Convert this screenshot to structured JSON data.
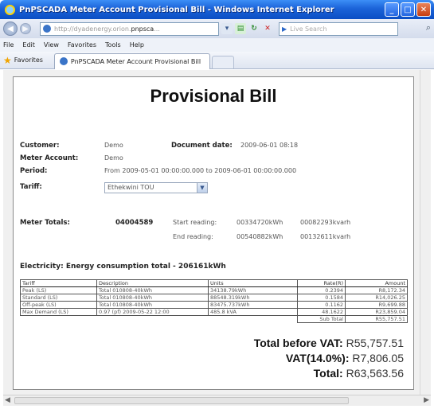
{
  "window": {
    "title": "PnPSCADA Meter Account Provisional Bill - Windows Internet Explorer",
    "min": "_",
    "max": "□",
    "close": "✕"
  },
  "address": {
    "url_prefix": "http://dyadenergy.orion.",
    "url_host": "pnpsca",
    "url_suffix": "...",
    "search_placeholder": "Live Search",
    "search_logo": "▶"
  },
  "menu": [
    "File",
    "Edit",
    "View",
    "Favorites",
    "Tools",
    "Help"
  ],
  "favbar": {
    "favorites_label": "Favorites",
    "tab_title": "PnPSCADA Meter Account Provisional Bill"
  },
  "bill": {
    "title": "Provisional Bill",
    "customer_label": "Customer:",
    "customer_value": "Demo",
    "document_date_label": "Document date:",
    "document_date_value": "2009-06-01 08:18",
    "meter_account_label": "Meter Account:",
    "meter_account_value": "Demo",
    "period_label": "Period:",
    "period_value": "From 2009-05-01 00:00:00.000 to 2009-06-01 00:00:00.000",
    "tariff_label": "Tariff:",
    "tariff_value": "Ethekwini TOU",
    "meter_totals_label": "Meter Totals:",
    "meter_number": "04004589",
    "start_reading_label": "Start reading:",
    "start_reading_kwh": "00334720kWh",
    "start_reading_kvarh": "00082293kvarh",
    "end_reading_label": "End reading:",
    "end_reading_kwh": "00540882kWh",
    "end_reading_kvarh": "00132611kvarh",
    "section_heading": "Electricity: Energy consumption total - 206161kWh",
    "table": {
      "headers": [
        "Tariff",
        "Description",
        "Units",
        "Rate(R)",
        "Amount"
      ],
      "rows": [
        [
          "Peak (LS)",
          "Total 010808-40kWh",
          "34138.79kWh",
          "0.2394",
          "R8,172.34"
        ],
        [
          "Standard (LS)",
          "Total 010808-40kWh",
          "88548.319kWh",
          "0.1584",
          "R14,026.25"
        ],
        [
          "Off-peak (LS)",
          "Total 010808-40kWh",
          "83475.737kWh",
          "0.1162",
          "R9,699.88"
        ],
        [
          "Max Demand (LS)",
          "0.97 (pf) 2009-05-22 12:00",
          "485.8 kVA",
          "48.1622",
          "R23,859.04"
        ]
      ],
      "subtotal_label": "Sub Total",
      "subtotal_value": "R55,757.51"
    },
    "total_before_vat_label": "Total before VAT:",
    "total_before_vat_value": "R55,757.51",
    "vat_label": "VAT(14.0%):",
    "vat_value": "R7,806.05",
    "total_label": "Total:",
    "total_value": "R63,563.56"
  }
}
